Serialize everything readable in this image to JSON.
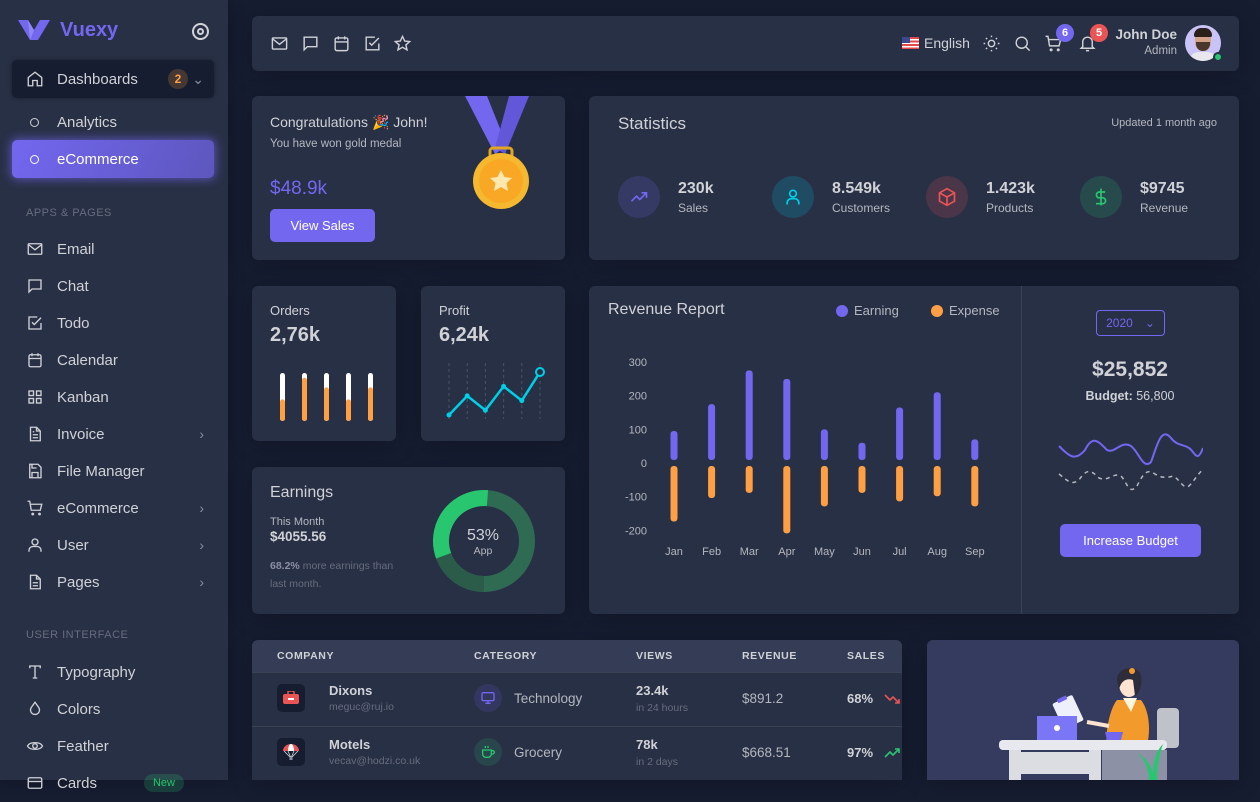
{
  "app": {
    "brand": "Vuexy"
  },
  "sidebar": {
    "dashboards": {
      "label": "Dashboards",
      "badge": "2"
    },
    "dashboard_children": [
      {
        "label": "Analytics",
        "active": false
      },
      {
        "label": "eCommerce",
        "active": true
      }
    ],
    "section_apps": "APPS & PAGES",
    "apps": [
      {
        "label": "Email",
        "icon": "mail-icon",
        "has_children": false
      },
      {
        "label": "Chat",
        "icon": "chat-icon",
        "has_children": false
      },
      {
        "label": "Todo",
        "icon": "check-square-icon",
        "has_children": false
      },
      {
        "label": "Calendar",
        "icon": "calendar-icon",
        "has_children": false
      },
      {
        "label": "Kanban",
        "icon": "grid-icon",
        "has_children": false
      },
      {
        "label": "Invoice",
        "icon": "file-text-icon",
        "has_children": true
      },
      {
        "label": "File Manager",
        "icon": "save-icon",
        "has_children": false
      },
      {
        "label": "eCommerce",
        "icon": "shopping-cart-icon",
        "has_children": true
      },
      {
        "label": "User",
        "icon": "user-icon",
        "has_children": true
      },
      {
        "label": "Pages",
        "icon": "file-icon",
        "has_children": true
      }
    ],
    "section_ui": "USER INTERFACE",
    "ui": [
      {
        "label": "Typography",
        "icon": "type-icon"
      },
      {
        "label": "Colors",
        "icon": "droplet-icon"
      },
      {
        "label": "Feather",
        "icon": "eye-icon"
      },
      {
        "label": "Cards",
        "icon": "credit-card-icon",
        "badge": "New"
      }
    ]
  },
  "navbar": {
    "bookmarks": [
      "mail-icon",
      "chat-icon",
      "calendar-icon",
      "check-square-icon",
      "star-icon"
    ],
    "language": "English",
    "cart_count": "6",
    "notification_count": "5",
    "user_name": "John Doe",
    "user_role": "Admin"
  },
  "congrats": {
    "title": "Congratulations 🎉 John!",
    "subtitle": "You have won gold medal",
    "amount": "$48.9k",
    "button": "View Sales"
  },
  "statistics": {
    "title": "Statistics",
    "updated": "Updated 1 month ago",
    "items": [
      {
        "value": "230k",
        "label": "Sales",
        "icon": "trending-up-icon",
        "color": "#7367f0"
      },
      {
        "value": "8.549k",
        "label": "Customers",
        "icon": "user-icon",
        "color": "#00cfe8"
      },
      {
        "value": "1.423k",
        "label": "Products",
        "icon": "box-icon",
        "color": "#ea5455"
      },
      {
        "value": "$9745",
        "label": "Revenue",
        "icon": "dollar-sign-icon",
        "color": "#28c76f"
      }
    ]
  },
  "orders": {
    "label": "Orders",
    "value": "2,76k",
    "bar_fill": [
      0.45,
      0.9,
      0.7,
      0.45,
      0.7
    ]
  },
  "profit": {
    "label": "Profit",
    "value": "6,24k",
    "points": [
      0,
      20,
      5,
      30,
      15,
      45
    ]
  },
  "earnings": {
    "title": "Earnings",
    "month_label": "This Month",
    "amount": "$4055.56",
    "note_highlight": "68.2%",
    "note_rest": " more earnings than last month.",
    "donut_percent": "53%",
    "donut_label": "App",
    "donut_share": 0.53
  },
  "revenue_report": {
    "title": "Revenue Report",
    "legend": [
      {
        "name": "Earning",
        "color": "#7367f0"
      },
      {
        "name": "Expense",
        "color": "#ff9f43"
      }
    ],
    "year": "2020",
    "budget_amount": "$25,852",
    "budget_label": "Budget:",
    "budget_value": "56,800",
    "button": "Increase Budget"
  },
  "chart_data": {
    "type": "bar",
    "title": "Revenue Report",
    "categories": [
      "Jan",
      "Feb",
      "Mar",
      "Apr",
      "May",
      "Jun",
      "Jul",
      "Aug",
      "Sep"
    ],
    "series": [
      {
        "name": "Earning",
        "values": [
          95,
          175,
          275,
          250,
          100,
          60,
          165,
          210,
          70
        ]
      },
      {
        "name": "Expense",
        "values": [
          -165,
          -95,
          -80,
          -200,
          -120,
          -80,
          -105,
          -90,
          -120
        ]
      }
    ],
    "yticks": [
      "300",
      "200",
      "100",
      "0",
      "-100",
      "-200"
    ],
    "ylim": [
      -200,
      300
    ],
    "legend": "top-right",
    "grid": false,
    "xlabel": "",
    "ylabel": ""
  },
  "table": {
    "headers": [
      "COMPANY",
      "CATEGORY",
      "VIEWS",
      "REVENUE",
      "SALES"
    ],
    "rows": [
      {
        "company": "Dixons",
        "email": "meguc@ruj.io",
        "company_icon": "toolbox-icon",
        "category": "Technology",
        "category_icon": "monitor-icon",
        "views": "23.4k",
        "views_period": "in 24 hours",
        "revenue": "$891.2",
        "sales": "68%",
        "trend": "down"
      },
      {
        "company": "Motels",
        "email": "vecav@hodzi.co.uk",
        "company_icon": "parachute-icon",
        "category": "Grocery",
        "category_icon": "coffee-icon",
        "views": "78k",
        "views_period": "in 2 days",
        "revenue": "$668.51",
        "sales": "97%",
        "trend": "up"
      }
    ]
  }
}
